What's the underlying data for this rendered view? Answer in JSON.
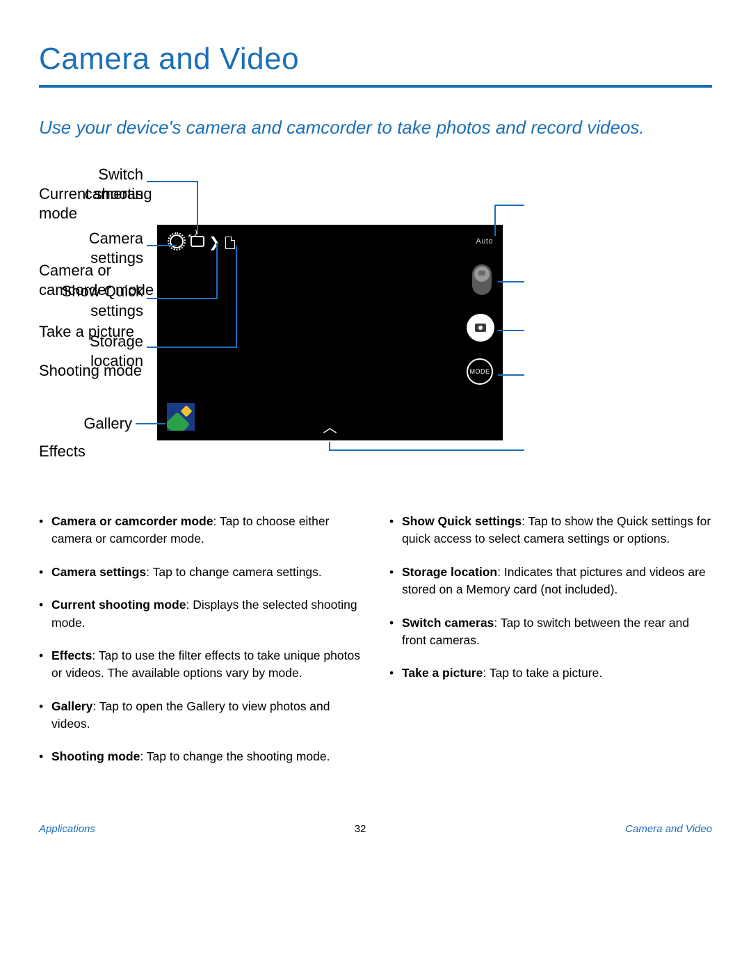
{
  "header": {
    "title": "Camera and Video"
  },
  "intro": "Use your device's camera and camcorder to take photos and record videos.",
  "labels": {
    "switch_cameras": "Switch cameras",
    "camera_settings": "Camera settings",
    "show_quick": "Show Quick settings",
    "storage": "Storage location",
    "gallery": "Gallery",
    "current_mode": "Current shooting mode",
    "cam_or_camcorder": "Camera or camcorder mode",
    "take_picture": "Take a picture",
    "shooting_mode": "Shooting mode",
    "effects": "Effects"
  },
  "screen": {
    "auto_label": "Auto",
    "mode_btn": "MODE"
  },
  "bullets_left": [
    {
      "term": "Camera or camcorder mode",
      "desc": ": Tap to choose either camera or camcorder mode."
    },
    {
      "term": "Camera settings",
      "desc": ": Tap to change camera settings."
    },
    {
      "term": "Current shooting mode",
      "desc": ": Displays the selected shooting mode."
    },
    {
      "term": "Effects",
      "desc": ": Tap to use the filter effects to take unique photos or videos. The available options vary by mode."
    },
    {
      "term": "Gallery",
      "desc": ": Tap to open the Gallery to view photos and videos."
    },
    {
      "term": "Shooting mode",
      "desc": ": Tap to change the shooting mode."
    }
  ],
  "bullets_right": [
    {
      "term": "Show Quick settings",
      "desc": ": Tap to show the Quick settings for quick access to select camera settings or options."
    },
    {
      "term": "Storage location",
      "desc": ": Indicates that pictures and videos are stored on a Memory card (not included)."
    },
    {
      "term": "Switch cameras",
      "desc": ": Tap to switch between the rear and front cameras."
    },
    {
      "term": "Take a picture",
      "desc": ": Tap to take a picture."
    }
  ],
  "footer": {
    "left": "Applications",
    "page": "32",
    "right": "Camera and Video"
  }
}
